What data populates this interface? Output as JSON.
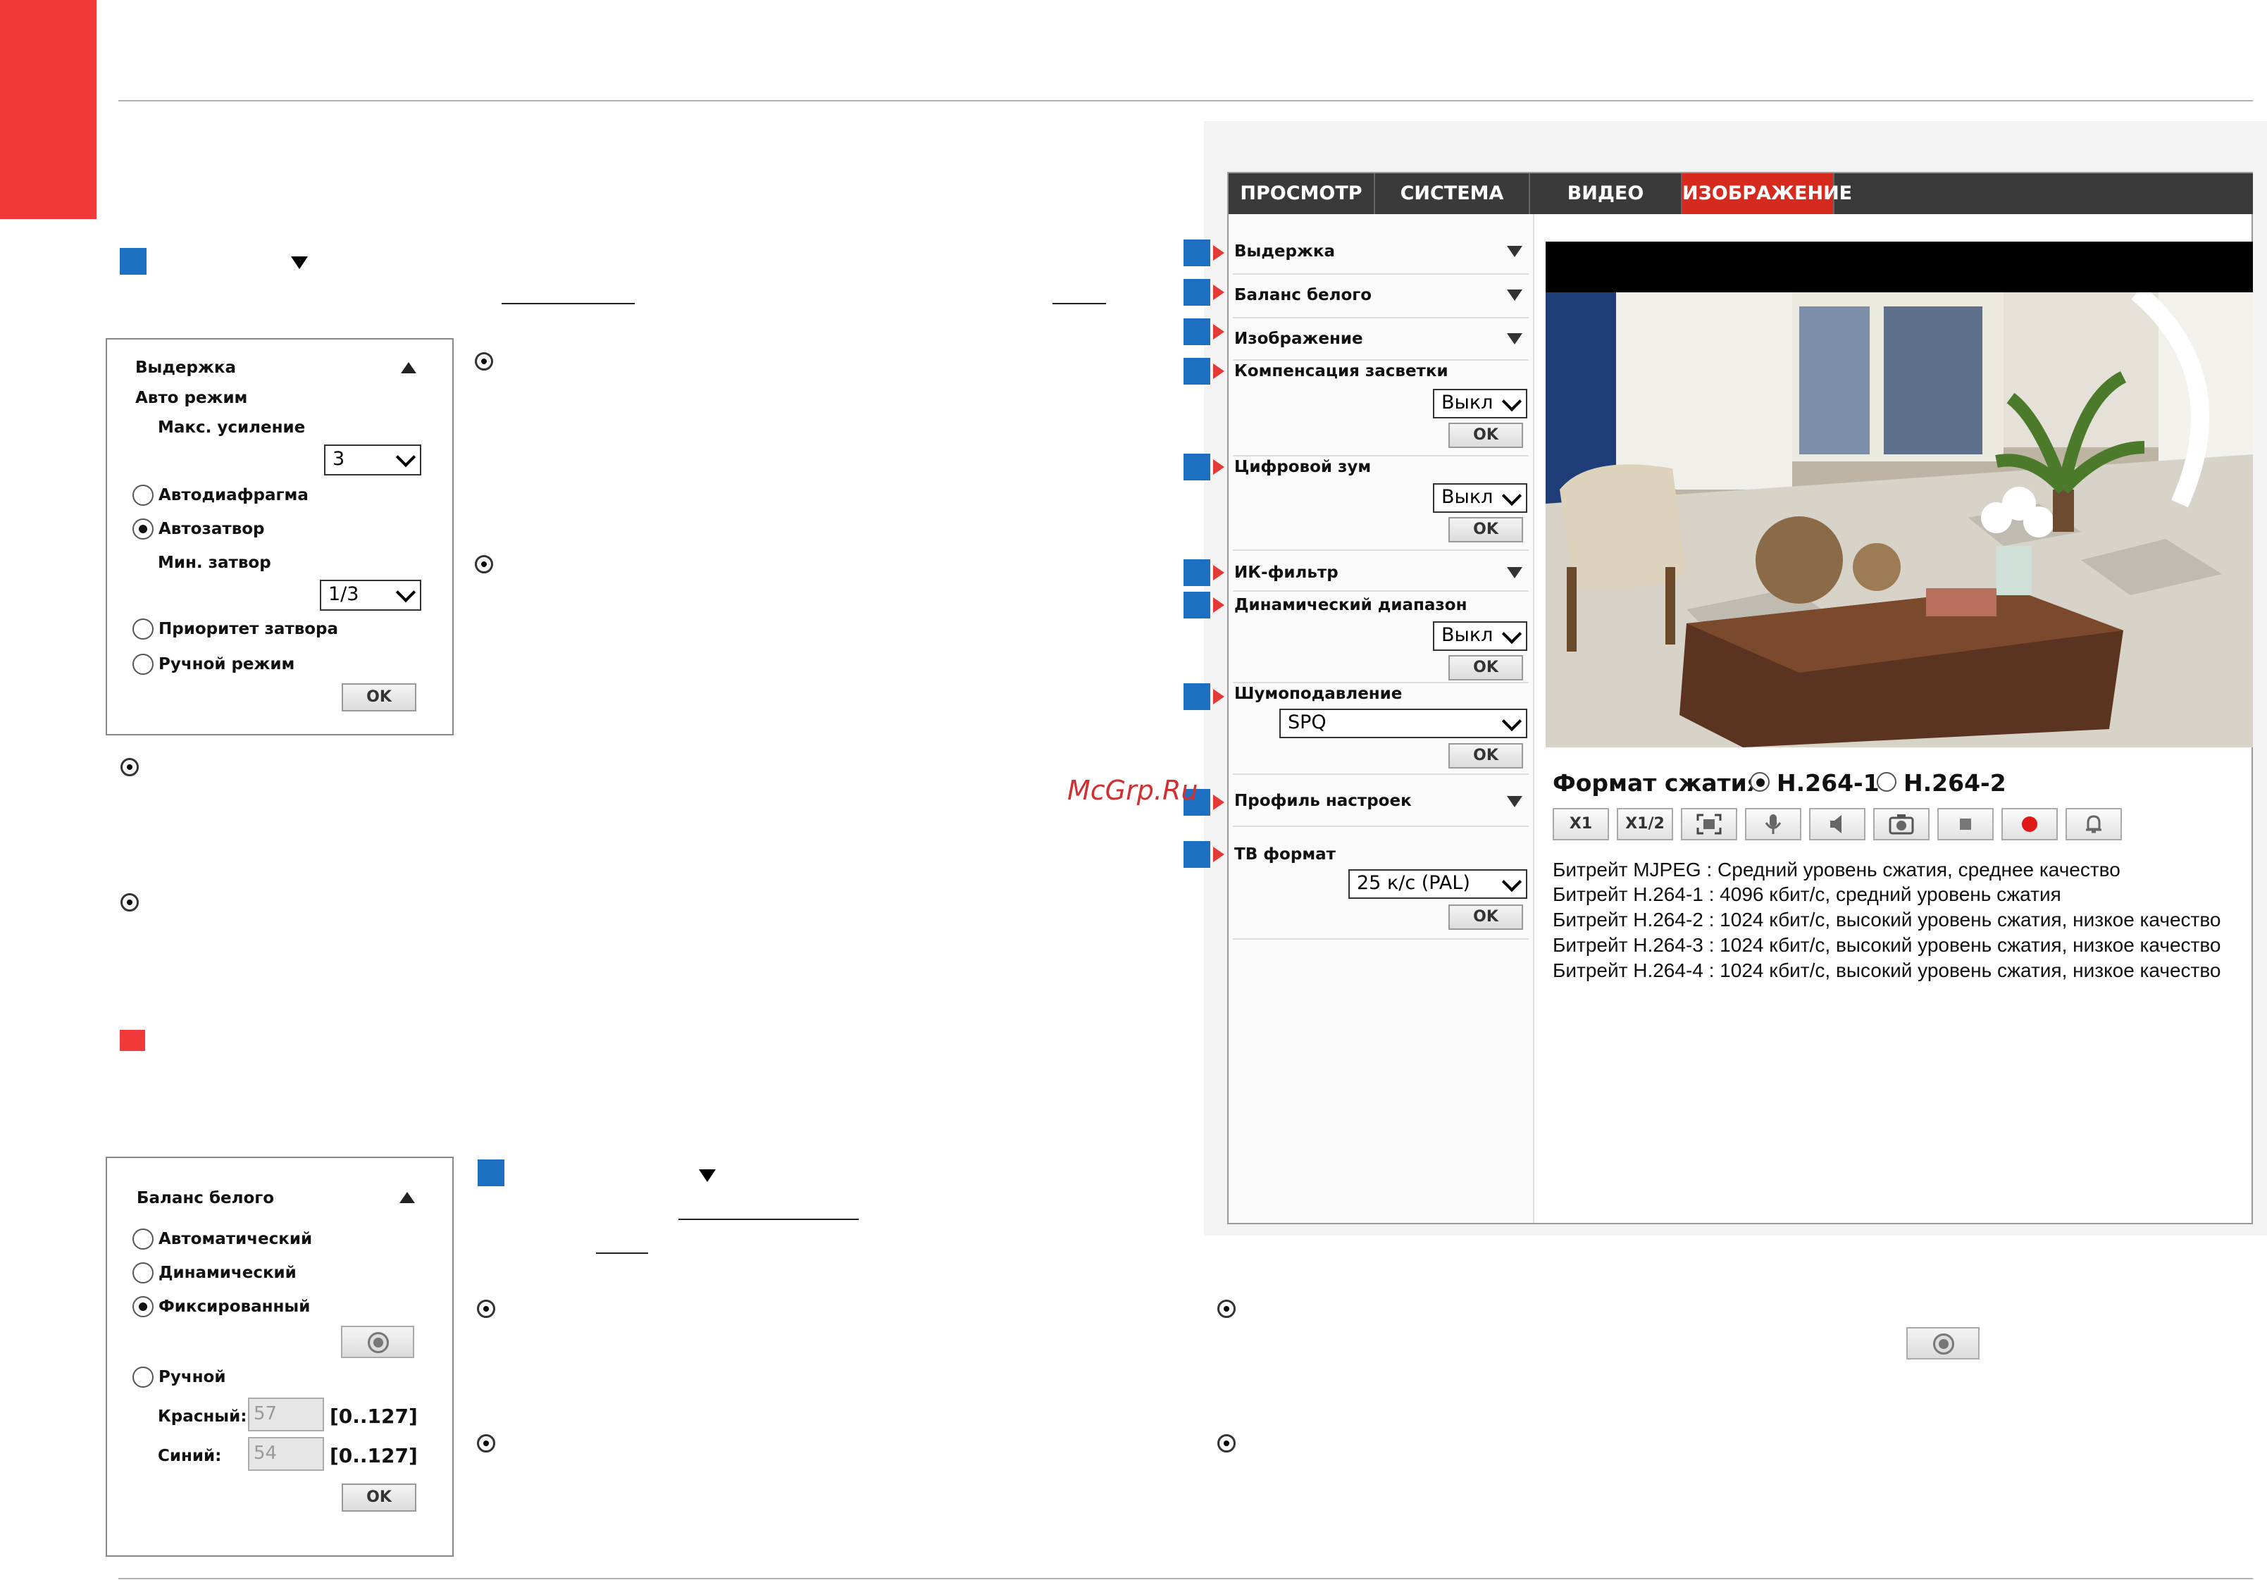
{
  "panel_exposure": {
    "title": "Выдержка",
    "auto_mode": "Авто режим",
    "max_gain_label": "Макс. усиление",
    "max_gain_value": "3",
    "opt_auto_iris": "Автодиафрагма",
    "opt_auto_shutter": "Автозатвор",
    "min_shutter_label": "Мин. затвор",
    "min_shutter_value": "1/3",
    "opt_shutter_priority": "Приоритет затвора",
    "opt_manual": "Ручной режим",
    "ok": "OK"
  },
  "panel_wb": {
    "title": "Баланс белого",
    "opt_auto": "Автоматический",
    "opt_dynamic": "Динамический",
    "opt_fixed": "Фиксированный",
    "opt_manual": "Ручной",
    "red_label": "Красный:",
    "red_value": "57",
    "red_range": "[0..127]",
    "blue_label": "Синий:",
    "blue_value": "54",
    "blue_range": "[0..127]",
    "ok": "OK"
  },
  "camera_ui": {
    "tabs": [
      "ПРОСМОТР",
      "СИСТЕМА",
      "ВИДЕО",
      "ИЗОБРАЖЕНИЕ"
    ],
    "menu": {
      "exposure": "Выдержка",
      "white_balance": "Баланс белого",
      "image": "Изображение",
      "backlight": "Компенсация засветки",
      "backlight_value": "Выкл",
      "digital_zoom": "Цифровой зум",
      "digital_zoom_value": "Выкл",
      "ir_filter": "ИК-фильтр",
      "dynamic_range": "Динамический диапазон",
      "dynamic_range_value": "Выкл",
      "noise_reduction": "Шумоподавление",
      "noise_reduction_value": "SPQ",
      "profile": "Профиль настроек",
      "tv_format": "ТВ формат",
      "tv_format_value": "25 к/с (PAL)",
      "ok": "OK"
    },
    "format_label": "Формат сжатия",
    "codec_1": "H.264-1",
    "codec_2": "H.264-2",
    "controls": [
      "X1",
      "X1/2"
    ],
    "bitrates": [
      "Битрейт MJPEG : Средний уровень сжатия, среднее качество",
      "Битрейт H.264-1 : 4096 кбит/с, средний уровень сжатия",
      "Битрейт H.264-2 : 1024 кбит/с, высокий уровень сжатия, низкое качество",
      "Битрейт H.264-3 : 1024 кбит/с, высокий уровень сжатия, низкое качество",
      "Битрейт H.264-4 : 1024 кбит/с, высокий уровень сжатия, низкое качество"
    ],
    "accent": "#d62a1f"
  },
  "watermark": "McGrp.Ru"
}
